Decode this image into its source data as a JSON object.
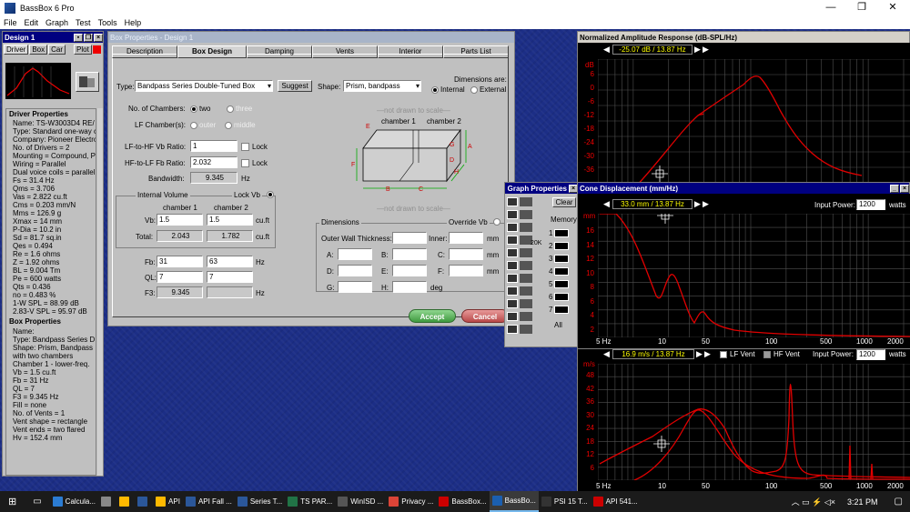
{
  "app": {
    "title": "BassBox 6 Pro",
    "menu": [
      "File",
      "Edit",
      "Graph",
      "Test",
      "Tools",
      "Help"
    ],
    "win_controls": [
      "—",
      "❐",
      "✕"
    ]
  },
  "design": {
    "title": "Design 1",
    "tabs": [
      "Driver",
      "Box",
      "Car"
    ],
    "plot_btn": "Plot",
    "driver_header": "Driver Properties",
    "driver_lines": [
      "Name: TS-W3003D4 RE/",
      "Type: Standard one-way c",
      "Company: Pioneer Electro",
      "No. of Drivers = 2",
      "Mounting = Compound, P",
      "Wiring = Parallel",
      "Dual voice coils = parallel",
      "Fs = 31.4 Hz",
      "Qms = 3.706",
      "Vas = 2.822 cu.ft",
      "Cms = 0.203 mm/N",
      "Mms = 126.9 g",
      "Xmax = 14 mm",
      "P-Dia = 10.2 in",
      "Sd = 81.7 sq.in",
      "Qes = 0.494",
      "Re = 1.6 ohms",
      "Z = 1.92 ohms",
      "BL = 9.004 Tm",
      "Pe = 600 watts",
      "Qts = 0.436",
      "no = 0.483 %",
      "1-W SPL = 88.99 dB",
      "2.83-V SPL = 95.97 dB"
    ],
    "box_header": "Box Properties",
    "box_lines": [
      "Name:",
      "Type: Bandpass Series D",
      "Shape: Prism, Bandpass",
      "  with two chambers",
      "Chamber 1 - lower-freq.",
      "  Vb = 1.5 cu.ft",
      "  Fb = 31 Hz",
      "  QL = 7",
      "  F3 = 9.345 Hz",
      "  Fill = none",
      "  No. of Vents = 1",
      "    Vent shape = rectangle",
      "    Vent ends = two flared",
      "    Hv = 152.4 mm"
    ]
  },
  "box": {
    "title": "Box Properties - Design 1",
    "tabs": [
      "Description",
      "Box Design",
      "Damping",
      "Vents",
      "Interior",
      "Parts List"
    ],
    "type_label": "Type:",
    "type_value": "Bandpass Series Double-Tuned Box",
    "suggest": "Suggest",
    "shape_label": "Shape:",
    "shape_value": "Prism, bandpass",
    "dims_are": "Dimensions are:",
    "internal": "Internal",
    "external": "External",
    "num_chambers": "No. of Chambers:",
    "two": "two",
    "three": "three",
    "lf_chambers": "LF Chamber(s):",
    "outer": "outer",
    "middle": "middle",
    "notdrawn": "—not drawn to scale—",
    "ch1": "chamber 1",
    "ch2": "chamber 2",
    "lfhf_vb_label": "LF-to-HF Vb Ratio:",
    "lfhf_vb": "1",
    "lock": "Lock",
    "hflf_fb_label": "HF-to-LF Fb Ratio:",
    "hflf_fb": "2.032",
    "bw_label": "Bandwidth:",
    "bw": "9.345",
    "hz": "Hz",
    "iv_label": "Internal Volume",
    "lockvb": "Lock Vb",
    "vb_label": "Vb:",
    "vb1": "1.5",
    "vb2": "1.5",
    "cuft": "cu.ft",
    "total_label": "Total:",
    "tot1": "2.043",
    "tot2": "1.782",
    "fb_label": "Fb:",
    "fb1": "31",
    "fb2": "63",
    "ql_label": "QL:",
    "ql1": "7",
    "ql2": "7",
    "f3_label": "F3:",
    "f3": "9.345",
    "dims_label": "Dimensions",
    "override": "Override Vb",
    "wall": "Outer Wall Thickness:",
    "inner": "Inner:",
    "mm": "mm",
    "deg": "deg",
    "dim_letters": [
      "A:",
      "B:",
      "C:",
      "D:",
      "E:",
      "F:",
      "G:",
      "H:"
    ],
    "accept": "Accept",
    "cancel": "Cancel"
  },
  "gp": {
    "title": "Graph Properties",
    "clear": "Clear",
    "memory": "Memory",
    "mem_nums": [
      "1",
      "2",
      "3",
      "4",
      "5",
      "6",
      "7"
    ],
    "all": "All",
    "k20": "20K"
  },
  "nar": {
    "title": "Normalized Amplitude Response (dB-SPL/Hz)",
    "readout": "-25.07 dB / 13.87 Hz",
    "unit": "dB",
    "yticks": [
      "6",
      "0",
      "-6",
      "-12",
      "-18",
      "-24",
      "-30",
      "-36"
    ]
  },
  "cone": {
    "title": "Cone Displacement (mm/Hz)",
    "readout": "33.0 mm / 13.87 Hz",
    "power_label": "Input Power:",
    "power": "1200",
    "watts": "watts",
    "unit": "mm",
    "yticks": [
      "16",
      "14",
      "12",
      "10",
      "8",
      "6",
      "4",
      "2"
    ],
    "xticks": [
      "5 Hz",
      "10",
      "50",
      "100",
      "500",
      "1000",
      "2000"
    ]
  },
  "vent": {
    "readout": "16.9 m/s / 13.87 Hz",
    "lf_vent": "LF Vent",
    "hf_vent": "HF Vent",
    "power_label": "Input Power:",
    "power": "1200",
    "watts": "watts",
    "unit": "m/s",
    "yticks": [
      "48",
      "42",
      "36",
      "30",
      "24",
      "18",
      "12",
      "6"
    ],
    "xticks": [
      "5 Hz",
      "10",
      "50",
      "100",
      "500",
      "1000",
      "2000"
    ]
  },
  "taskbar": {
    "items": [
      "Calcula...",
      "",
      "",
      "",
      "API",
      "API Fall ...",
      "Series T...",
      "TS PAR...",
      "WinISD ...",
      "Privacy ...",
      "BassBox...",
      "BassBo...",
      "PSI 15 T...",
      "API 541..."
    ],
    "time": "3:21 PM"
  },
  "colors": {
    "accent": "#e00000",
    "grid": "#505050",
    "title_active": "#000080"
  }
}
